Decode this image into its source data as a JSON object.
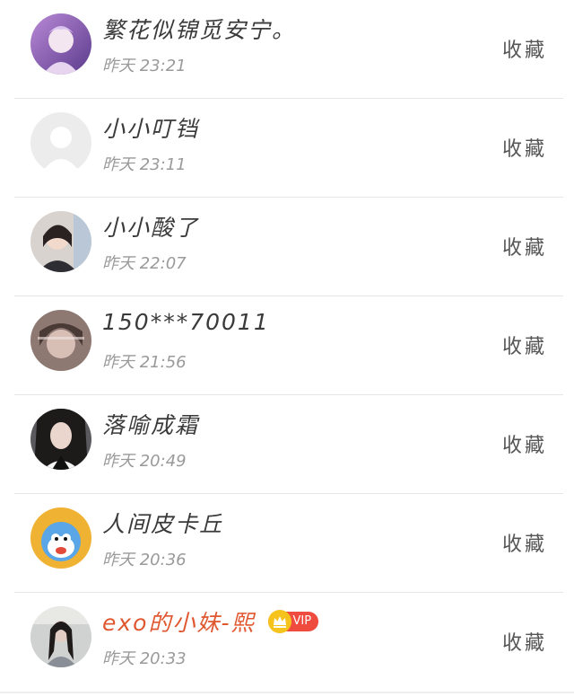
{
  "list": {
    "favorite_label": "收藏",
    "items": [
      {
        "name": "繁花似锦觅安宁。",
        "time": "昨天 23:21"
      },
      {
        "name": "小小叮铛",
        "time": "昨天 23:11"
      },
      {
        "name": "小小酸了",
        "time": "昨天 22:07"
      },
      {
        "name": "150***70011",
        "time": "昨天 21:56"
      },
      {
        "name": "落喻成霜",
        "time": "昨天 20:49"
      },
      {
        "name": "人间皮卡丘",
        "time": "昨天 20:36"
      },
      {
        "name": "exo的小妹-熙",
        "time": "昨天 20:33",
        "badge": "VIP"
      }
    ]
  },
  "colors": {
    "vip_name": "#e0572f",
    "vip_badge": "#ef4b3f",
    "crown": "#f6c21c"
  }
}
